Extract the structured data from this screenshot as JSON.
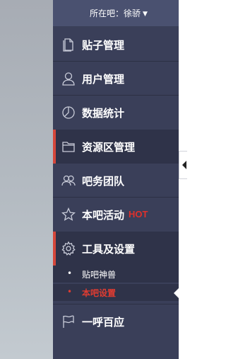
{
  "header": {
    "top_partial": "",
    "forum_label": "所在吧：徐骄"
  },
  "menu": {
    "items": [
      {
        "label": "贴子管理",
        "icon": "document-icon"
      },
      {
        "label": "用户管理",
        "icon": "user-icon"
      },
      {
        "label": "数据统计",
        "icon": "chart-clock-icon"
      },
      {
        "label": "资源区管理",
        "icon": "folder-icon",
        "active": true
      },
      {
        "label": "吧务团队",
        "icon": "team-icon"
      },
      {
        "label": "本吧活动",
        "icon": "star-icon",
        "badge": "HOT"
      },
      {
        "label": "工具及设置",
        "icon": "gear-icon",
        "active": true,
        "expanded": true
      },
      {
        "label": "一呼百应",
        "icon": "flag-icon"
      }
    ],
    "submenu": [
      {
        "label": "贴吧神兽",
        "selected": false
      },
      {
        "label": "本吧设置",
        "selected": true
      }
    ]
  },
  "colors": {
    "sidebar": "#3a3f59",
    "active_row": "#2f3349",
    "accent": "#d5473b",
    "hot": "#e0302b"
  }
}
